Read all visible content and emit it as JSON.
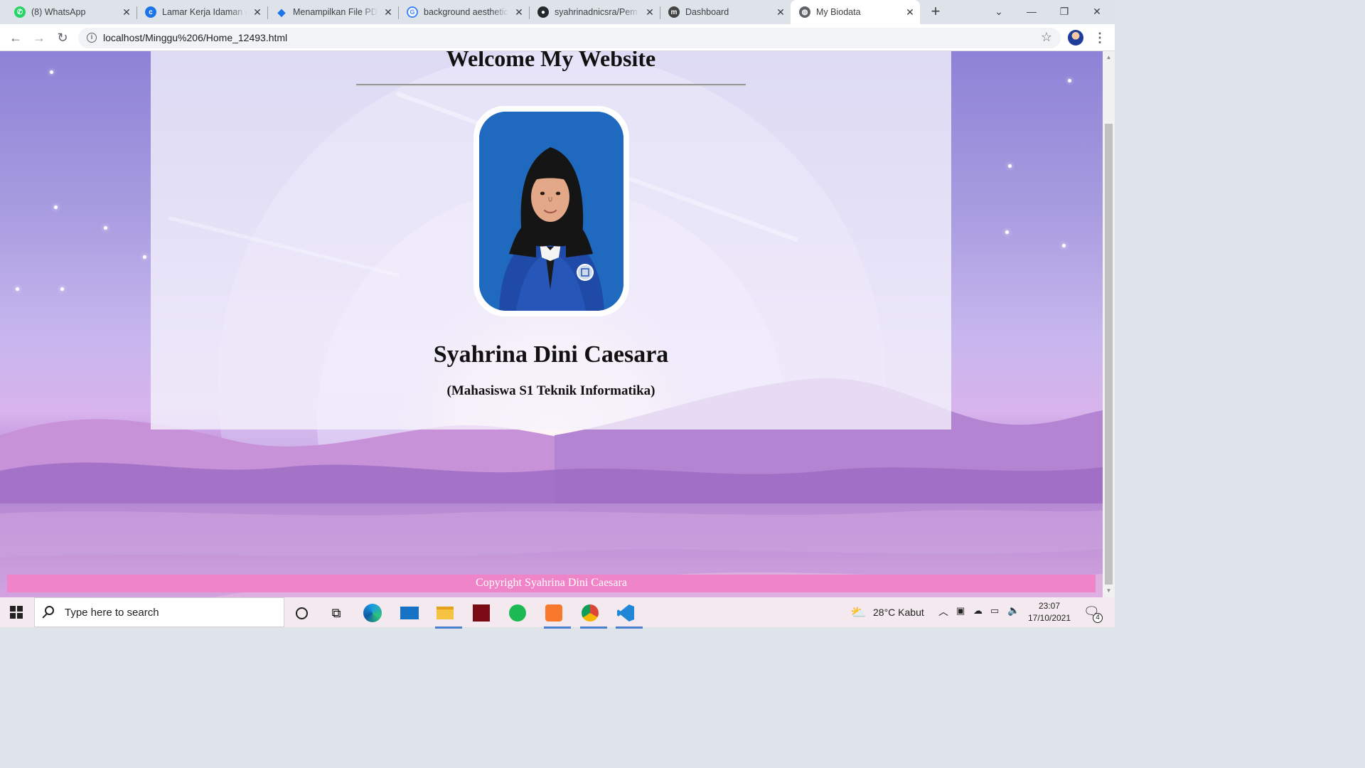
{
  "browser": {
    "tabs": [
      {
        "title": "(8) WhatsApp",
        "favicon": "whatsapp-icon",
        "color": "#25d366",
        "active": false
      },
      {
        "title": "Lamar Kerja Idaman di",
        "favicon": "c-logo-icon",
        "color": "#1c74e8",
        "active": false
      },
      {
        "title": "Menampilkan File PDF",
        "favicon": "drive-diamond-icon",
        "color": "#1a73e8",
        "active": false
      },
      {
        "title": "background aesthetic",
        "favicon": "google-icon",
        "color": "#4285f4",
        "active": false
      },
      {
        "title": "syahrinadnicsra/Pem",
        "favicon": "github-icon",
        "color": "#24292e",
        "active": false
      },
      {
        "title": "Dashboard",
        "favicon": "moodle-icon",
        "color": "#444444",
        "active": false
      },
      {
        "title": "My Biodata",
        "favicon": "globe-icon",
        "color": "#5f6368",
        "active": true
      }
    ],
    "address": "localhost/Minggu%206/Home_12493.html"
  },
  "page": {
    "site_title": "Welcome My Website",
    "person_name": "Syahrina Dini Caesara",
    "person_role": "(Mahasiswa S1 Teknik Informatika)",
    "footer": "Copyright Syahrina Dini Caesara"
  },
  "taskbar": {
    "search_placeholder": "Type here to search",
    "weather": "28°C  Kabut",
    "time": "23:07",
    "date": "17/10/2021",
    "notification_count": "4"
  }
}
